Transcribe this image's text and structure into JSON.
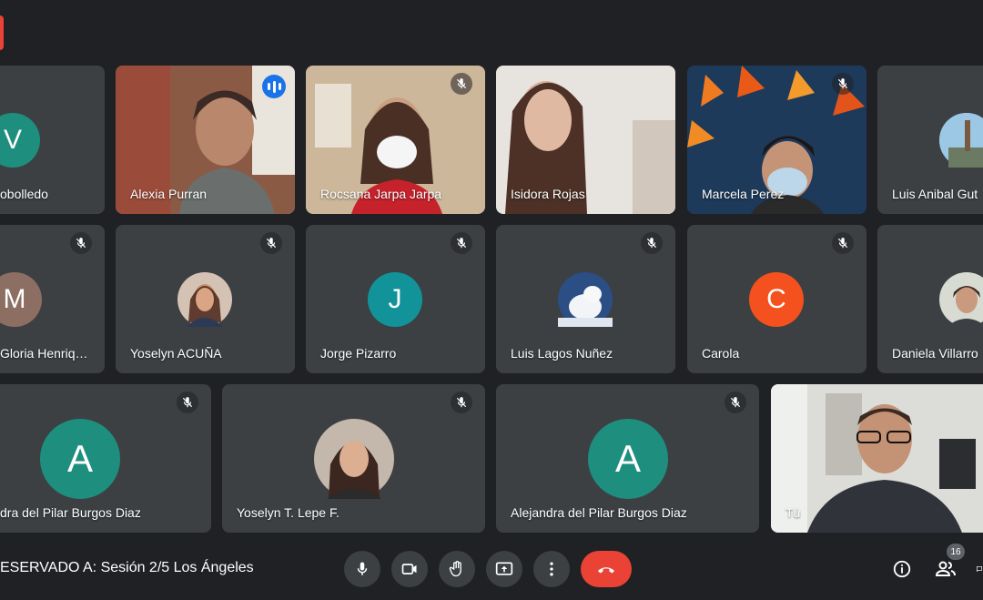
{
  "participants": [
    {
      "name": "Alexia Purran"
    },
    {
      "name": "Rocsana Jarpa Jarpa"
    },
    {
      "name": "Isidora Rojas"
    },
    {
      "name": "Marcela Perez"
    },
    {
      "name": "Luis Anibal Gut"
    },
    {
      "name": "Gloria Henriq…",
      "initial": "M"
    },
    {
      "name": "Yoselyn ACUÑA"
    },
    {
      "name": "Jorge Pizarro",
      "initial": "J"
    },
    {
      "name": "Luis Lagos Nuñez"
    },
    {
      "name": "Carola",
      "initial": "C"
    },
    {
      "name": "Daniela Villarro"
    },
    {
      "name": "dra del Pilar Burgos Diaz",
      "initial": "A"
    },
    {
      "name": "Yoselyn T. Lepe F."
    },
    {
      "name": "Alejandra del Pilar Burgos Diaz",
      "initial": "A"
    },
    {
      "name": "Tú"
    },
    {
      "name": "obolledo",
      "initial": "V"
    }
  ],
  "meeting": {
    "title": "ESERVADO A: Sesión 2/5 Los Ángeles"
  },
  "controls": {
    "participants_count": "16"
  },
  "colors": {
    "background": "#202124",
    "tile": "#3c4043",
    "active_outline": "#8ab4f8",
    "end_call": "#ea4335",
    "avatar_teal": "#1e8e7e",
    "avatar_brown": "#8d6e63",
    "avatar_cyan": "#12939a",
    "avatar_orange": "#f4511e"
  },
  "icons": [
    "mic-off-icon",
    "speaking-icon",
    "mic-icon",
    "camera-icon",
    "raise-hand-icon",
    "present-icon",
    "more-icon",
    "end-call-icon",
    "info-icon",
    "people-icon",
    "chat-icon"
  ]
}
